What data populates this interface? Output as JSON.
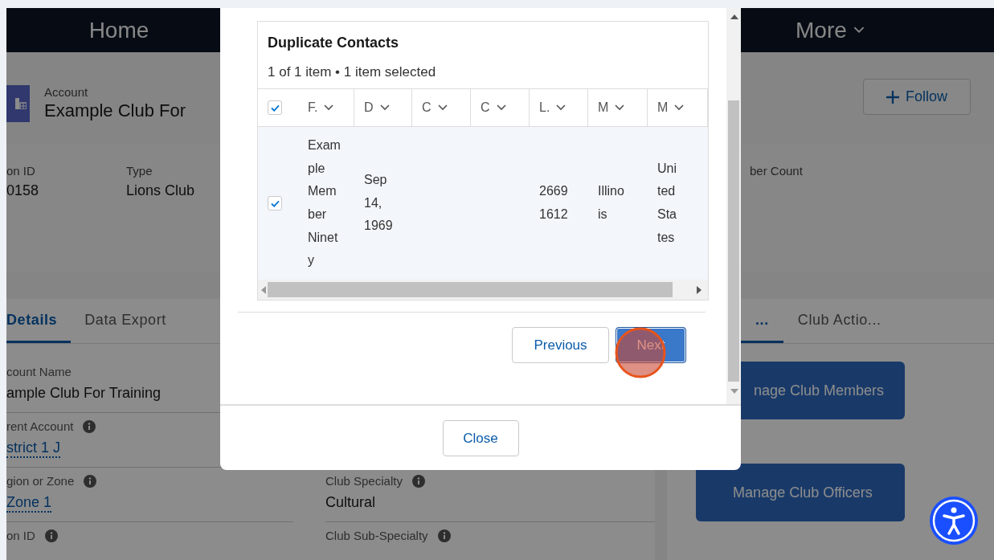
{
  "nav": [
    {
      "label": "Home",
      "kind": "link"
    },
    {
      "label": "More",
      "kind": "menu"
    }
  ],
  "record_header": {
    "object_type": "Account",
    "title": "Example Club For",
    "follow_button": "Follow"
  },
  "highlights": [
    {
      "label": "on ID",
      "value": "0158"
    },
    {
      "label": "Type",
      "value": "Lions Club"
    },
    {
      "label": "ber Count"
    }
  ],
  "details_card": {
    "tabs": [
      {
        "label": "Details",
        "selected": true
      },
      {
        "label": "Data Export",
        "selected": false
      }
    ],
    "fields_left": [
      {
        "label": "count Name",
        "info": false,
        "value": "ample Club For Training",
        "kind": "text"
      },
      {
        "label": "rent Account",
        "info": true,
        "value": "strict 1 J",
        "kind": "link"
      },
      {
        "label": "gion or Zone",
        "info": true,
        "value": "Zone 1",
        "kind": "link"
      },
      {
        "label": "on ID",
        "info": true
      }
    ],
    "fields_right": [
      {
        "label": "Club Specialty",
        "info": true,
        "value": "Cultural",
        "kind": "text"
      },
      {
        "label": "Club Sub-Specialty",
        "info": true
      }
    ]
  },
  "actions_card": {
    "tabs": [
      {
        "label": "...",
        "selected": true
      },
      {
        "label": "Club Actio...",
        "selected": false
      }
    ],
    "buttons": [
      "nage Club Members",
      "Manage Club Officers"
    ]
  },
  "modal": {
    "title": "Duplicate Contacts",
    "summary": "1 of 1 item • 1 item selected",
    "select_all_checked": true,
    "columns": [
      {
        "label": "F."
      },
      {
        "label": "D"
      },
      {
        "label": "C"
      },
      {
        "label": "C"
      },
      {
        "label": "L."
      },
      {
        "label": "M"
      },
      {
        "label": "M"
      }
    ],
    "rows": [
      {
        "selected": true,
        "cells": [
          "Example Member Ninety",
          "Sep 14, 1969",
          null,
          null,
          "26691612",
          "Illinois",
          "United States"
        ]
      }
    ],
    "previous_button": "Previous",
    "next_button": "Next",
    "close_button": "Close"
  }
}
